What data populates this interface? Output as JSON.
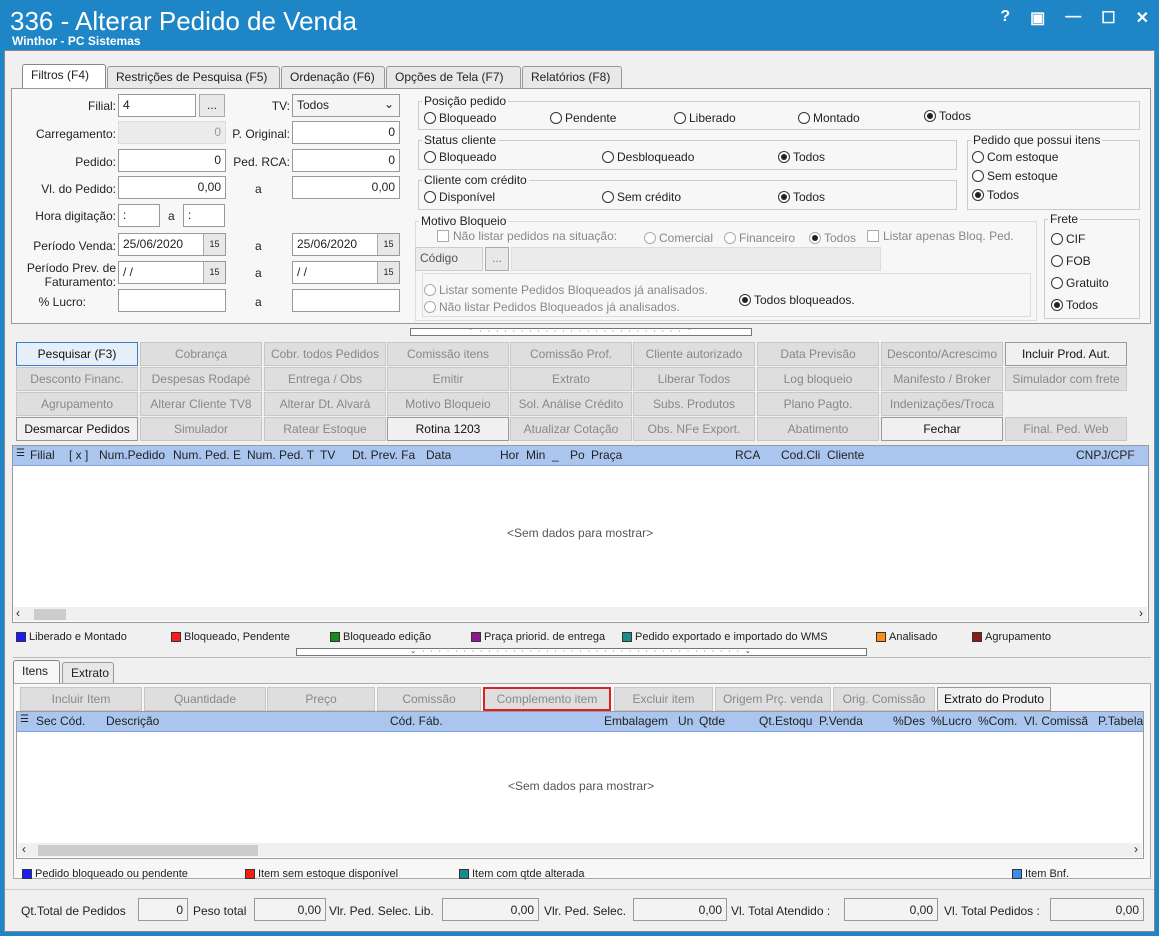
{
  "window": {
    "title": "336 - Alterar Pedido de Venda",
    "subtitle": "Winthor - PC Sistemas",
    "help": "?",
    "restore": "▣",
    "minimize": "—",
    "maximize": "☐",
    "close": "✕"
  },
  "tabs": [
    "Filtros (F4)",
    "Restrições de Pesquisa (F5)",
    "Ordenação (F6)",
    "Opções de Tela (F7)",
    "Relatórios (F8)"
  ],
  "filters": {
    "filial_label": "Filial:",
    "filial_value": "4",
    "ellipsis": "...",
    "tv_label": "TV:",
    "tv_value": "Todos",
    "carregamento_label": "Carregamento:",
    "carregamento_value": "0",
    "p_original_label": "P. Original:",
    "p_original_value": "0",
    "pedido_label": "Pedido:",
    "pedido_value": "0",
    "ped_rca_label": "Ped. RCA:",
    "ped_rca_value": "0",
    "vl_pedido_label": "Vl. do Pedido:",
    "vl_pedido_from": "0,00",
    "vl_pedido_to": "0,00",
    "a": "a",
    "hora_label": "Hora digitação:",
    "hora_from": " :",
    "hora_to": " :",
    "periodo_venda_label": "Período Venda:",
    "periodo_venda_from": "25/06/2020",
    "periodo_venda_to": "25/06/2020",
    "periodo_prev_label1": "Período Prev. de",
    "periodo_prev_label2": "Faturamento:",
    "periodo_prev_from": " /  /",
    "periodo_prev_to": " /  /",
    "lucro_label": "% Lucro:",
    "cal": "15"
  },
  "posicao": {
    "label": "Posição pedido",
    "options": [
      "Bloqueado",
      "Pendente",
      "Liberado",
      "Montado",
      "Todos"
    ],
    "selected": "Todos"
  },
  "status_cliente": {
    "label": "Status cliente",
    "options": [
      "Bloqueado",
      "Desbloqueado",
      "Todos"
    ],
    "selected": "Todos"
  },
  "cliente_credito": {
    "label": "Cliente com crédito",
    "options": [
      "Disponível",
      "Sem crédito",
      "Todos"
    ],
    "selected": "Todos"
  },
  "itens": {
    "label": "Pedido que possui itens",
    "options": [
      "Com estoque",
      "Sem estoque",
      "Todos"
    ],
    "selected": "Todos"
  },
  "motivo": {
    "label": "Motivo Bloqueio",
    "nao_listar": "Não listar pedidos na situação:",
    "options": [
      "Comercial",
      "Financeiro",
      "Todos"
    ],
    "listar_apenas": "Listar apenas Bloq. Ped.",
    "codigo": "Código",
    "ellipsis": "...",
    "listar_somente": "Listar somente Pedidos Bloqueados já analisados.",
    "nao_listar_analisados": "Não listar Pedidos Bloqueados já analisados.",
    "todos_bloqueados": "Todos bloqueados."
  },
  "frete": {
    "label": "Frete",
    "options": [
      "CIF",
      "FOB",
      "Gratuito",
      "Todos"
    ],
    "selected": "Todos"
  },
  "buttons": [
    [
      "Pesquisar (F3)",
      "Cobrança",
      "Cobr. todos Pedidos",
      "Comissão itens",
      "Comissão Prof.",
      "Cliente autorizado",
      "Data Previsão",
      "Desconto/Acrescimo",
      "Incluir Prod. Aut."
    ],
    [
      "Desconto Financ.",
      "Despesas Rodapé",
      "Entrega / Obs",
      "Emitir",
      "Extrato",
      "Liberar Todos",
      "Log bloqueio",
      "Manifesto / Broker",
      "Simulador com frete"
    ],
    [
      "Agrupamento",
      "Alterar Cliente TV8",
      "Alterar Dt. Alvará",
      "Motivo Bloqueio",
      "Sol. Análise Crédito",
      "Subs. Produtos",
      "Plano Pagto.",
      "Indenizações/Troca"
    ],
    [
      "Desmarcar Pedidos",
      "Simulador",
      "Ratear Estoque",
      "Rotina 1203",
      "Atualizar Cotação",
      "Obs. NFe Export.",
      "Abatimento",
      "Fechar",
      "Final. Ped. Web"
    ]
  ],
  "grid1": {
    "columns": [
      "Filial",
      "[ x ]",
      "Num.Pedido",
      "Num. Ped. E",
      "Num. Ped. T",
      "TV",
      "Dt. Prev. Fa",
      "Data",
      "Hor",
      "Min",
      "_",
      "Po",
      "Praça",
      "RCA",
      "Cod.Cli",
      "Cliente",
      "CNPJ/CPF"
    ],
    "empty": "<Sem dados para mostrar>"
  },
  "legend1": [
    {
      "label": "Liberado e Montado",
      "color": "#1a1aff"
    },
    {
      "label": "Bloqueado, Pendente",
      "color": "#ff1a1a"
    },
    {
      "label": "Bloqueado edição",
      "color": "#1a8c1a"
    },
    {
      "label": "Praça priorid. de entrega",
      "color": "#8c1a8c"
    },
    {
      "label": "Pedido exportado e importado do WMS",
      "color": "#1a8c8c"
    },
    {
      "label": "Analisado",
      "color": "#ff8c1a"
    },
    {
      "label": "Agrupamento",
      "color": "#8c1a1a"
    }
  ],
  "bottom_tabs": [
    "Itens",
    "Extrato"
  ],
  "item_buttons": [
    "Incluir Item",
    "Quantidade",
    "Preço",
    "Comissão",
    "Complemento item",
    "Excluir item",
    "Origem Prç. venda",
    "Orig. Comissão",
    "Extrato do Produto"
  ],
  "grid2": {
    "columns": [
      "Sec",
      "Cód.",
      "Descrição",
      "Cód. Fáb.",
      "Embalagem",
      "Un",
      "Qtde",
      "Qt.Estoqu",
      "P.Venda",
      "%Des",
      "%Lucro",
      "%Com.",
      "Vl. Comissã",
      "P.Tabela"
    ],
    "empty": "<Sem dados para mostrar>"
  },
  "legend2": [
    {
      "label": "Pedido bloqueado ou pendente",
      "color": "#1a1aff"
    },
    {
      "label": "Item sem estoque disponível",
      "color": "#ff1a1a"
    },
    {
      "label": "Item com qtde alterada",
      "color": "#1a8c8c"
    },
    {
      "label": "Item Bnf.",
      "color": "#3b8ef0"
    }
  ],
  "totals": {
    "qt_total_label": "Qt.Total de Pedidos",
    "qt_total": "0",
    "peso_label": "Peso total",
    "peso": "0,00",
    "vlr_lib_label": "Vlr. Ped. Selec. Lib.",
    "vlr_lib": "0,00",
    "vlr_sel_label": "Vlr. Ped. Selec.",
    "vlr_sel": "0,00",
    "vl_atendido_label": "Vl. Total Atendido :",
    "vl_atendido": "0,00",
    "vl_pedidos_label": "Vl. Total Pedidos :",
    "vl_pedidos": "0,00"
  },
  "colors": {
    "titlebar": "#1e86c6",
    "grid_header": "#aac6ef",
    "highlight": "#e02020"
  }
}
